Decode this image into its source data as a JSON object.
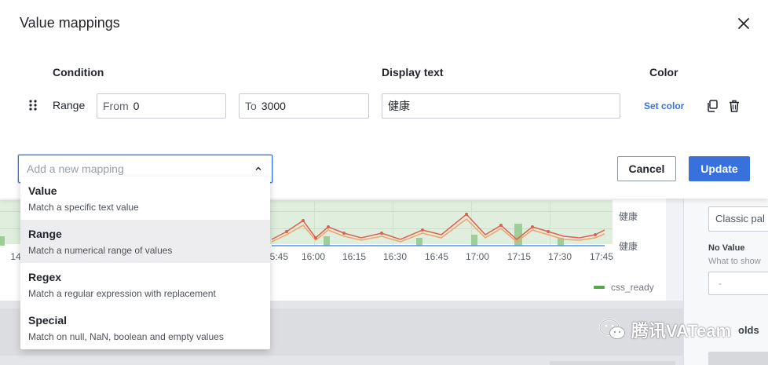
{
  "modal": {
    "title": "Value mappings",
    "headers": {
      "condition": "Condition",
      "display_text": "Display text",
      "color": "Color"
    },
    "mapping_row": {
      "type": "Range",
      "from_prefix": "From",
      "from_value": "0",
      "to_prefix": "To",
      "to_value": "3000",
      "display_text": "健康",
      "set_color_label": "Set color"
    },
    "add_mapping_placeholder": "Add a new mapping",
    "cancel_label": "Cancel",
    "update_label": "Update"
  },
  "dropdown": {
    "items": [
      {
        "label": "Value",
        "description": "Match a specific text value",
        "active": false
      },
      {
        "label": "Range",
        "description": "Match a numerical range of values",
        "active": true
      },
      {
        "label": "Regex",
        "description": "Match a regular expression with replacement",
        "active": false
      },
      {
        "label": "Special",
        "description": "Match on null, NaN, boolean and empty values",
        "active": false
      }
    ]
  },
  "background": {
    "chart": {
      "y_labels": [
        "健康",
        "健康"
      ],
      "x_ticks": [
        "14",
        "15:45",
        "16:00",
        "16:15",
        "16:30",
        "16:45",
        "17:00",
        "17:15",
        "17:30",
        "17:45"
      ],
      "legend": "css_ready"
    },
    "sidebar": {
      "color_scheme": "Classic pal",
      "no_value_label": "No Value",
      "no_value_hint": "What to show",
      "no_value_placeholder": "-",
      "thresholds_label": "olds"
    }
  },
  "watermark": {
    "text": "腾讯VATeam"
  },
  "colors": {
    "accent": "#3871dc",
    "series_red": "#e0604f",
    "series_orange": "#f2a36c",
    "series_green": "#56a64b",
    "series_blue": "#5794f2"
  },
  "icons": {
    "close": "close-icon",
    "drag": "drag-handle-icon",
    "copy": "copy-icon",
    "trash": "trash-icon",
    "chevron": "chevron-up-icon"
  }
}
